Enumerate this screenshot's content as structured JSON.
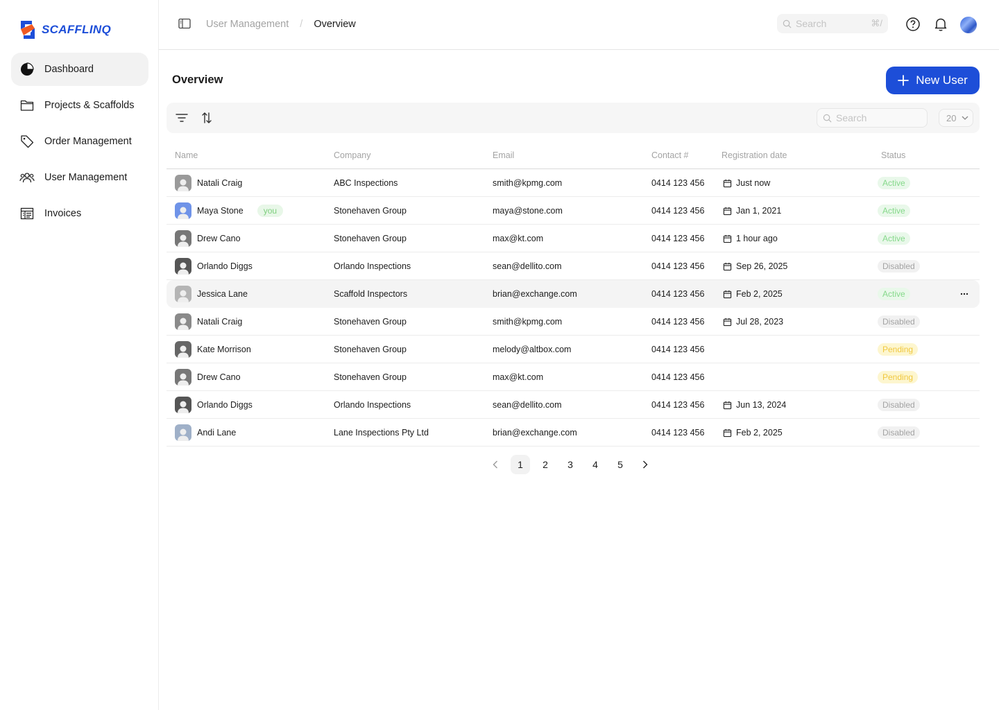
{
  "brand": {
    "name": "SCAFFLINQ",
    "primary": "#1d4ed8",
    "accent": "#f15a22"
  },
  "sidebar": {
    "items": [
      {
        "label": "Dashboard",
        "icon": "pie-chart-icon",
        "active": true
      },
      {
        "label": "Projects & Scaffolds",
        "icon": "folder-icon",
        "active": false
      },
      {
        "label": "Order Management",
        "icon": "tag-icon",
        "active": false
      },
      {
        "label": "User Management",
        "icon": "users-icon",
        "active": false
      },
      {
        "label": "Invoices",
        "icon": "invoice-icon",
        "active": false
      }
    ]
  },
  "header": {
    "breadcrumb": {
      "parent": "User Management",
      "separator": "/",
      "current": "Overview"
    },
    "search": {
      "placeholder": "Search",
      "shortcut": "⌘/"
    }
  },
  "page": {
    "title": "Overview",
    "new_user_label": "New User"
  },
  "toolbar": {
    "search_placeholder": "Search",
    "page_size": "20"
  },
  "table": {
    "columns": [
      "Name",
      "Company",
      "Email",
      "Contact #",
      "Registration date",
      "Status"
    ],
    "rows": [
      {
        "name": "Natali Craig",
        "company": "ABC Inspections",
        "email": "smith@kpmg.com",
        "contact": "0414 123 456",
        "date": "Just now",
        "status": "Active"
      },
      {
        "name": "Maya Stone",
        "you": "you",
        "company": "Stonehaven Group",
        "email": "maya@stone.com",
        "contact": "0414 123 456",
        "date": "Jan 1, 2021",
        "status": "Active"
      },
      {
        "name": "Drew Cano",
        "company": "Stonehaven Group",
        "email": "max@kt.com",
        "contact": "0414 123 456",
        "date": "1 hour ago",
        "status": "Active"
      },
      {
        "name": "Orlando Diggs",
        "company": "Orlando Inspections",
        "email": "sean@dellito.com",
        "contact": "0414 123 456",
        "date": "Sep 26, 2025",
        "status": "Disabled"
      },
      {
        "name": "Jessica Lane",
        "company": "Scaffold Inspectors",
        "email": "brian@exchange.com",
        "contact": "0414 123 456",
        "date": "Feb 2, 2025",
        "status": "Active",
        "hover": true
      },
      {
        "name": "Natali Craig",
        "company": "Stonehaven Group",
        "email": "smith@kpmg.com",
        "contact": "0414 123 456",
        "date": "Jul 28, 2023",
        "status": "Disabled"
      },
      {
        "name": "Kate Morrison",
        "company": "Stonehaven Group",
        "email": "melody@altbox.com",
        "contact": "0414 123 456",
        "date": "",
        "status": "Pending"
      },
      {
        "name": "Drew Cano",
        "company": "Stonehaven Group",
        "email": "max@kt.com",
        "contact": "0414 123 456",
        "date": "",
        "status": "Pending"
      },
      {
        "name": "Orlando Diggs",
        "company": "Orlando Inspections",
        "email": "sean@dellito.com",
        "contact": "0414 123 456",
        "date": "Jun 13, 2024",
        "status": "Disabled"
      },
      {
        "name": "Andi Lane",
        "company": "Lane Inspections Pty Ltd",
        "email": "brian@exchange.com",
        "contact": "0414 123 456",
        "date": "Feb 2, 2025",
        "status": "Disabled"
      }
    ]
  },
  "pagination": {
    "pages": [
      "1",
      "2",
      "3",
      "4",
      "5"
    ],
    "current": "1"
  }
}
